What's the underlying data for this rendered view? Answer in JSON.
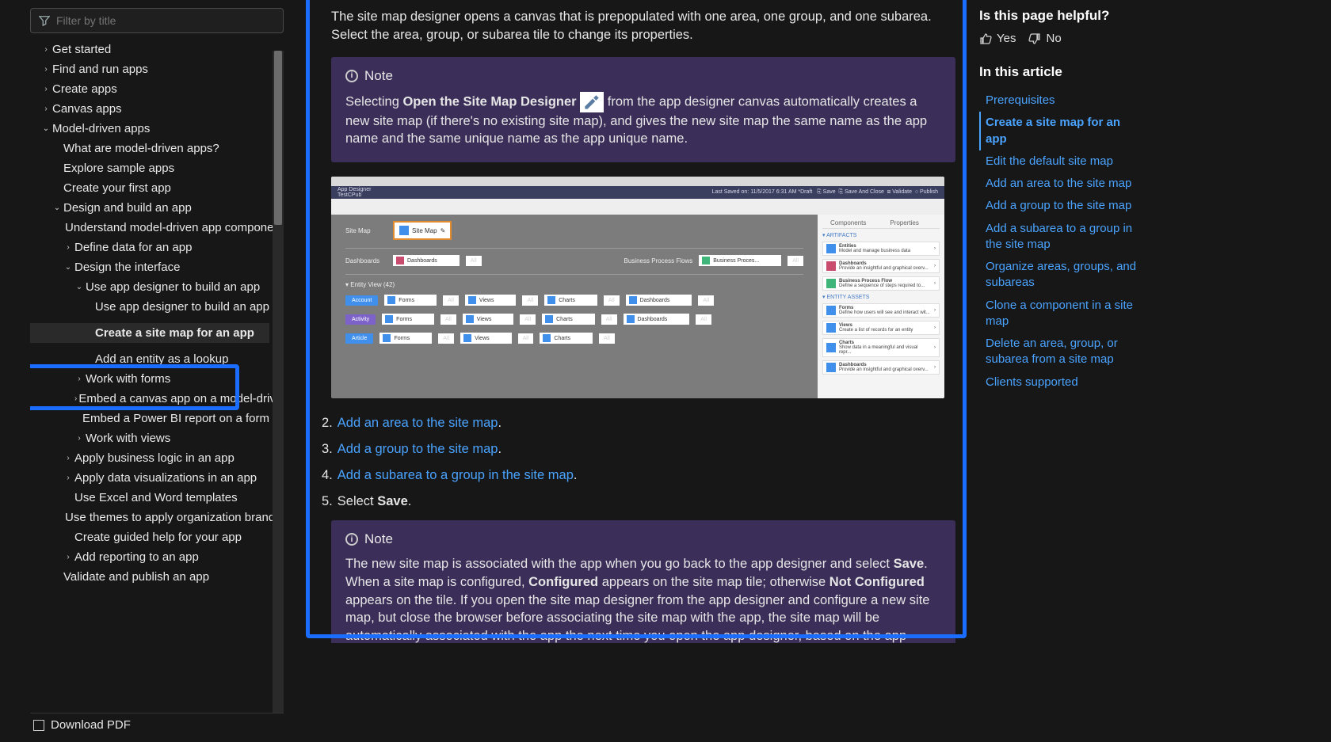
{
  "filter": {
    "placeholder": "Filter by title"
  },
  "nav": {
    "items": [
      {
        "label": "Get started",
        "indent": 1,
        "chev": "›"
      },
      {
        "label": "Find and run apps",
        "indent": 1,
        "chev": "›"
      },
      {
        "label": "Create apps",
        "indent": 1,
        "chev": "›"
      },
      {
        "label": "Canvas apps",
        "indent": 1,
        "chev": "›"
      },
      {
        "label": "Model-driven apps",
        "indent": 1,
        "chev": "⌄"
      },
      {
        "label": "What are model-driven apps?",
        "indent": 2,
        "chev": ""
      },
      {
        "label": "Explore sample apps",
        "indent": 2,
        "chev": ""
      },
      {
        "label": "Create your first app",
        "indent": 2,
        "chev": ""
      },
      {
        "label": "Design and build an app",
        "indent": 2,
        "chev": "⌄"
      },
      {
        "label": "Understand model-driven app components",
        "indent": 3,
        "chev": ""
      },
      {
        "label": "Define data for an app",
        "indent": 3,
        "chev": "›"
      },
      {
        "label": "Design the interface",
        "indent": 3,
        "chev": "⌄"
      },
      {
        "label": "Use app designer to build an app",
        "indent": 4,
        "chev": "⌄"
      },
      {
        "label": "Use app designer to build an app",
        "indent": 5,
        "chev": ""
      },
      {
        "label": "",
        "indent": 5,
        "chev": ""
      },
      {
        "label": "Create a site map for an app",
        "indent": 5,
        "chev": "",
        "selected": true
      },
      {
        "label": "",
        "indent": 5,
        "chev": ""
      },
      {
        "label": "Add an entity as a lookup",
        "indent": 5,
        "chev": ""
      },
      {
        "label": "Work with forms",
        "indent": 4,
        "chev": "›"
      },
      {
        "label": "Embed a canvas app on a model-driven form",
        "indent": 4,
        "chev": "›"
      },
      {
        "label": "Embed a Power BI report on a form",
        "indent": 4,
        "chev": ""
      },
      {
        "label": "Work with views",
        "indent": 4,
        "chev": "›"
      },
      {
        "label": "Apply business logic in an app",
        "indent": 3,
        "chev": "›"
      },
      {
        "label": "Apply data visualizations in an app",
        "indent": 3,
        "chev": "›"
      },
      {
        "label": "Use Excel and Word templates",
        "indent": 3,
        "chev": ""
      },
      {
        "label": "Use themes to apply organization branding",
        "indent": 3,
        "chev": ""
      },
      {
        "label": "Create guided help for your app",
        "indent": 3,
        "chev": ""
      },
      {
        "label": "Add reporting to an app",
        "indent": 3,
        "chev": "›"
      },
      {
        "label": "Validate and publish an app",
        "indent": 2,
        "chev": ""
      }
    ],
    "download": "Download PDF"
  },
  "main": {
    "intro": "The site map designer opens a canvas that is prepopulated with one area, one group, and one subarea. Select the area, group, or subarea tile to change its properties.",
    "note1": {
      "title": "Note",
      "before": "Selecting ",
      "bold": "Open the Site Map Designer",
      "after": " from the app designer canvas automatically creates a new site map (if there's no existing site map), and gives the new site map the same name as the app name and the same unique name as the app unique name."
    },
    "mock": {
      "topleft": "App Designer",
      "sub": "TestCPub",
      "topright": "Last Saved on: 11/5/2017 6:31 AM *Draft",
      "save": "Save",
      "saveclose": "Save And Close",
      "validate": "Validate",
      "publish": "Publish",
      "sitemap": "Site Map",
      "sitemaptile": "Site Map",
      "dashboards": "Dashboards",
      "bpf": "Business Process Flows",
      "account": "Account",
      "activity": "Activity",
      "article": "Article",
      "forms": "Forms",
      "views": "Views",
      "charts": "Charts",
      "dash": "Dashboards",
      "all": "All",
      "entity": "▾ Entity View (42)",
      "right": {
        "tabs": {
          "components": "Components",
          "properties": "Properties"
        },
        "artifacts": "▾ ARTIFACTS",
        "entities": "Entities",
        "entities_sub": "Model and manage business data",
        "dashlbl": "Dashboards",
        "dashlbl_sub": "Provide an insightful and graphical overv...",
        "bpflbl": "Business Process Flow",
        "bpflbl_sub": "Define a sequence of steps required to...",
        "assets": "▾ ENTITY ASSETS",
        "formslbl": "Forms",
        "formslbl_sub": "Define how users will see and interact wit...",
        "viewslbl": "Views",
        "viewslbl_sub": "Create a list of records for an entity",
        "chartslbl": "Charts",
        "chartslbl_sub": "Show data in a meaningful and visual repr...",
        "dash2lbl": "Dashboards",
        "dash2lbl_sub": "Provide an insightful and graphical overv..."
      }
    },
    "list": {
      "n2": "2.",
      "l2": "Add an area to the site map",
      "p2": ".",
      "n3": "3.",
      "l3": "Add a group to the site map",
      "p3": ".",
      "n4": "4.",
      "l4": "Add a subarea to a group in the site map",
      "p4": ".",
      "n5": "5.",
      "t5a": "Select ",
      "t5b": "Save",
      "t5c": "."
    },
    "note2": {
      "title": "Note",
      "t1": "The new site map is associated with the app when you go back to the app designer and select ",
      "b1": "Save",
      "t2": ". When a site map is configured, ",
      "b2": "Configured",
      "t3": " appears on the site map tile; otherwise ",
      "b3": "Not Configured",
      "t4": " appears on the tile. If you open the site map designer from the app designer and configure a new site map, but close the browser before associating the site map with the app, the site map will be automatically associated with the app the next time you open the app designer, based on the app unique name."
    }
  },
  "right": {
    "helpful": "Is this page helpful?",
    "yes": "Yes",
    "no": "No",
    "inthis": "In this article",
    "toc": [
      {
        "label": "Prerequisites",
        "active": false
      },
      {
        "label": "Create a site map for an app",
        "active": true
      },
      {
        "label": "Edit the default site map",
        "active": false
      },
      {
        "label": "Add an area to the site map",
        "active": false
      },
      {
        "label": "Add a group to the site map",
        "active": false
      },
      {
        "label": "Add a subarea to a group in the site map",
        "active": false
      },
      {
        "label": "Organize areas, groups, and subareas",
        "active": false
      },
      {
        "label": "Clone a component in a site map",
        "active": false
      },
      {
        "label": "Delete an area, group, or subarea from a site map",
        "active": false
      },
      {
        "label": "Clients supported",
        "active": false
      }
    ]
  }
}
